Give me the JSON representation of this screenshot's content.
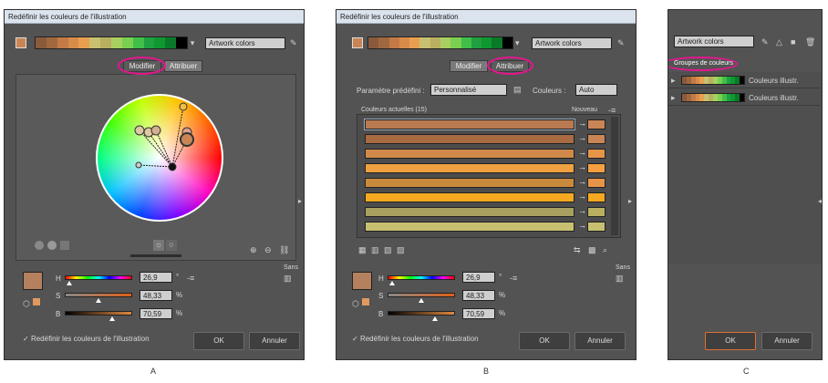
{
  "captions": [
    "A",
    "B",
    "C"
  ],
  "dialog_title": "Redéfinir les couleurs de l'illustration",
  "artwork_field": "Artwork colors",
  "tabs": {
    "edit": "Modifier",
    "assign": "Attribuer"
  },
  "palette": [
    "#8a5a3c",
    "#a0683e",
    "#c47a45",
    "#d88c4a",
    "#e8a050",
    "#c8c070",
    "#b8b060",
    "#a8d060",
    "#7ad050",
    "#40c048",
    "#20a040",
    "#109830",
    "#0a7a2a",
    "#000000"
  ],
  "hsb": {
    "h_label": "H",
    "h_value": "26,9",
    "h_unit": "°",
    "s_label": "S",
    "s_value": "48,33",
    "s_unit": "%",
    "b_label": "B",
    "b_value": "70,59",
    "b_unit": "%",
    "sans_label": "Sans",
    "base_color": "#b4805e"
  },
  "recolor_checkbox": "Redéfinir les couleurs de l'illustration",
  "ok": "OK",
  "cancel": "Annuler",
  "assign_panel": {
    "preset_label": "Paramètre prédéfini :",
    "preset_value": "Personnalisé",
    "colors_label": "Couleurs :",
    "colors_value": "Auto",
    "current_header": "Couleurs actuelles (15)",
    "new_header": "Nouveau",
    "rows": [
      {
        "cur": "#b97a52",
        "new": "#c98555"
      },
      {
        "cur": "#a86a40",
        "new": "#c98555"
      },
      {
        "cur": "#d0894a",
        "new": "#e69548"
      },
      {
        "cur": "#f0a040",
        "new": "#f4a040"
      },
      {
        "cur": "#c9893c",
        "new": "#e69548"
      },
      {
        "cur": "#f5a820",
        "new": "#f5a820"
      },
      {
        "cur": "#a8a060",
        "new": "#b8b060"
      },
      {
        "cur": "#c8c070",
        "new": "#c8c070"
      }
    ]
  },
  "groups_panel": {
    "header": "Groupes de couleurs",
    "items": [
      "Couleurs illustr.",
      "Couleurs illustr."
    ]
  },
  "colors": {
    "accent": "#e6158f",
    "dialog_bg": "#535353",
    "titlebar": "#dbe4ee"
  }
}
